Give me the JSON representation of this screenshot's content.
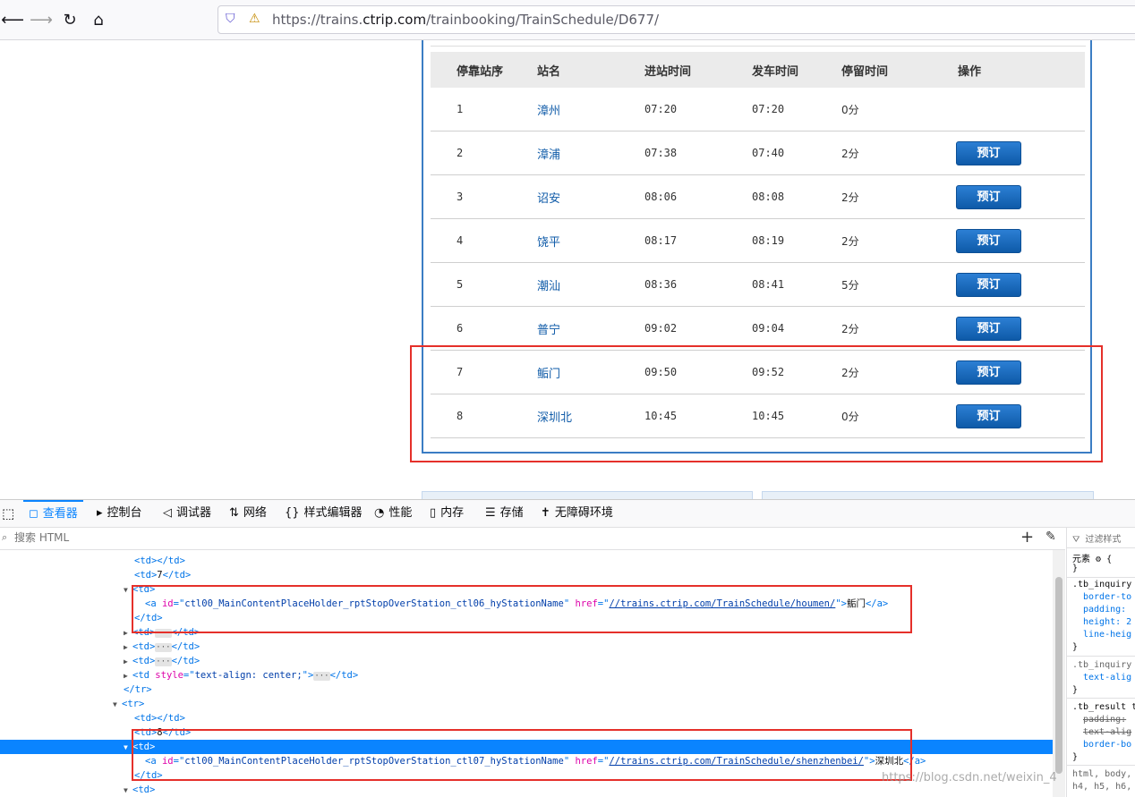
{
  "browser": {
    "url_prefix": "https://trains.",
    "url_domain": "ctrip.com",
    "url_path": "/trainbooking/TrainSchedule/D677/"
  },
  "schedule": {
    "headers": [
      "停靠站序",
      "站名",
      "进站时间",
      "发车时间",
      "停留时间",
      "操作"
    ],
    "book_label": "预订",
    "rows": [
      {
        "seq": "1",
        "station": "漳州",
        "arrive": "07:20",
        "depart": "07:20",
        "stay": "0分",
        "book": false
      },
      {
        "seq": "2",
        "station": "漳浦",
        "arrive": "07:38",
        "depart": "07:40",
        "stay": "2分",
        "book": true
      },
      {
        "seq": "3",
        "station": "诏安",
        "arrive": "08:06",
        "depart": "08:08",
        "stay": "2分",
        "book": true
      },
      {
        "seq": "4",
        "station": "饶平",
        "arrive": "08:17",
        "depart": "08:19",
        "stay": "2分",
        "book": true
      },
      {
        "seq": "5",
        "station": "潮汕",
        "arrive": "08:36",
        "depart": "08:41",
        "stay": "5分",
        "book": true
      },
      {
        "seq": "6",
        "station": "普宁",
        "arrive": "09:02",
        "depart": "09:04",
        "stay": "2分",
        "book": true
      },
      {
        "seq": "7",
        "station": "鲘门",
        "arrive": "09:50",
        "depart": "09:52",
        "stay": "2分",
        "book": true
      },
      {
        "seq": "8",
        "station": "深圳北",
        "arrive": "10:45",
        "depart": "10:45",
        "stay": "0分",
        "book": true
      }
    ]
  },
  "devtools": {
    "tabs": [
      {
        "icon": "◻",
        "label": "查看器"
      },
      {
        "icon": "▸",
        "label": "控制台"
      },
      {
        "icon": "◁",
        "label": "调试器"
      },
      {
        "icon": "⇅",
        "label": "网络"
      },
      {
        "icon": "{}",
        "label": "样式编辑器"
      },
      {
        "icon": "◔",
        "label": "性能"
      },
      {
        "icon": "▯",
        "label": "内存"
      },
      {
        "icon": "☰",
        "label": "存储"
      },
      {
        "icon": "✝",
        "label": "无障碍环境"
      }
    ],
    "search_placeholder": "搜索 HTML",
    "rules_filter": "过滤样式",
    "markup": {
      "l1": "<td></td>",
      "l2_seq": "7",
      "a_id_1": "ctl00_MainContentPlaceHolder_rptStopOverStation_ctl06_hyStationName",
      "href_1": "//trains.ctrip.com/TrainSchedule/houmen/",
      "text_1": "鲘门",
      "l2b_seq": "8",
      "a_id_2": "ctl00_MainContentPlaceHolder_rptStopOverStation_ctl07_hyStationName",
      "href_2": "//trains.ctrip.com/TrainSchedule/shenzhenbei/",
      "text_2": "深圳北",
      "style_attr": "text-align: center;"
    },
    "rules": {
      "element": "元素",
      "r1_sel": ".tb_inquiry",
      "r1_p1": "border-to",
      "r1_p2": "padding:",
      "r1_p3": "height: 2",
      "r1_p4": "line-heig",
      "r2_sel": ".tb_inquiry",
      "r2_p1": "text-alig",
      "r3_sel": ".tb_result t",
      "r3_p1": "padding:",
      "r3_p2": "text-alig",
      "r3_p3": "border-bo",
      "r4_sel": "html, body,",
      "r4_sel2": "h4, h5, h6,"
    }
  },
  "watermark": "https://blog.csdn.net/weixin_4"
}
